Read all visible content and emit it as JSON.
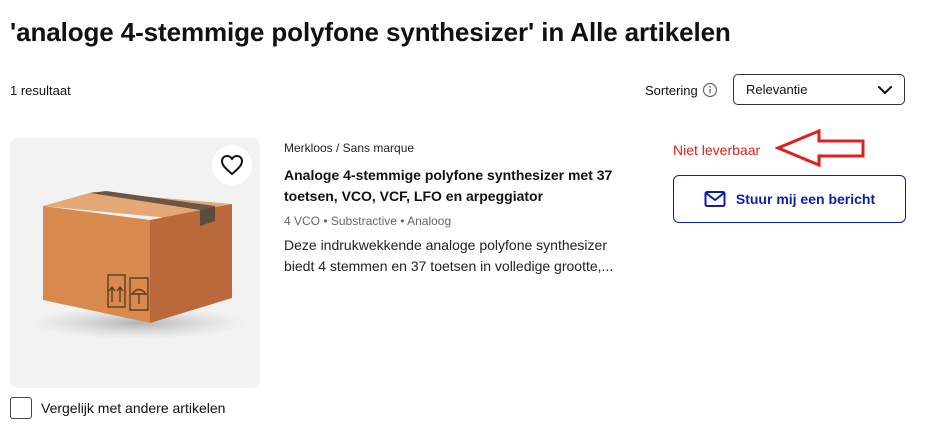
{
  "page": {
    "title": "'analoge 4-stemmige polyfone synthesizer' in Alle artikelen",
    "result_count": "1 resultaat"
  },
  "sort": {
    "label": "Sortering",
    "selected": "Relevantie",
    "info_icon": "info-icon",
    "dropdown_icon": "chevron-down-icon"
  },
  "product": {
    "brand": "Merkloos / Sans marque",
    "title": "Analoge 4-stemmige polyfone synthesizer met 37 toetsen, VCO, VCF, LFO en arpeggiator",
    "specs": "4 VCO • Substractive • Analoog",
    "description_line1": "Deze indrukwekkende analoge polyfone synthesizer",
    "description_line2": "biedt 4 stemmen en 37 toetsen in volledige grootte,...",
    "availability": "Niet leverbaar",
    "message_button": "Stuur mij een bericht",
    "compare_label": "Vergelijk met andere artikelen",
    "image_icon": "cardboard-box-image",
    "favorite_icon": "heart-icon",
    "mail_icon": "envelope-icon"
  },
  "colors": {
    "accent_blue": "#0b1ea8",
    "unavailable_red": "#e0201a",
    "annotation_arrow": "#e0201a"
  }
}
